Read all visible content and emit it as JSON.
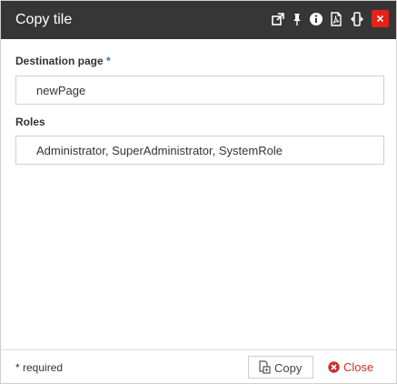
{
  "dialog": {
    "title": "Copy tile",
    "toolbar_icons": [
      "external-link-icon",
      "pin-icon",
      "info-icon",
      "pdf-icon",
      "resize-width-icon"
    ],
    "close_icon": "close-icon"
  },
  "form": {
    "destination": {
      "label": "Destination page",
      "required_mark": "*",
      "value": "newPage"
    },
    "roles": {
      "label": "Roles",
      "value": "Administrator, SuperAdministrator, SystemRole"
    }
  },
  "footer": {
    "required_note": "* required",
    "copy_label": "Copy",
    "close_label": "Close"
  },
  "colors": {
    "titlebar": "#363636",
    "close_red": "#e52219",
    "required_blue": "#2f6fb5",
    "close_text": "#c9302c"
  }
}
